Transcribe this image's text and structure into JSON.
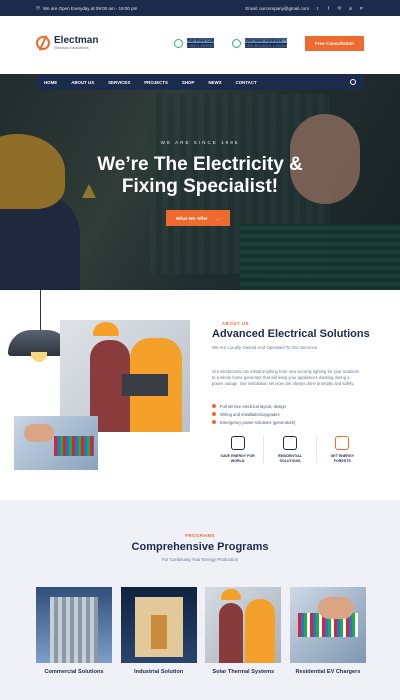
{
  "topbar": {
    "hours": "We are Open Everyday at 09:00 am - 19:00 pm",
    "email": "Email: ourcompany@gmail.com",
    "social": [
      "t",
      "f",
      "◎",
      "in",
      "P"
    ]
  },
  "header": {
    "brand": "Electman",
    "tagline": "Electrical Installations",
    "call_title": "Toll Free Call",
    "call_value": "(+557) 964587",
    "address_title": "Our New Address",
    "address_value": "55/5 Brooklyn, London",
    "cta": "Free Consultation"
  },
  "nav": [
    "HOME",
    "ABOUT US",
    "SERVICES",
    "PROJECTS",
    "SHOP",
    "NEWS",
    "CONTACT"
  ],
  "hero": {
    "since": "WE ARE SINCE 1995",
    "title_line1": "We’re The Electricity &",
    "title_line2": "Fixing Specialist!",
    "button": "What We Offer"
  },
  "about": {
    "sub": "ABOUT US",
    "title": "Advanced Electrical Solutions",
    "lead": "We Are Locally Owned And Operated To Our Services",
    "text": "Our electricians can install anything from new security lighting for your outdoors to a whole home generator that will keep your appliances working during a power outage. Our installation services are always done promptly and safely.",
    "list": [
      "Full service electrical layout, design",
      "Wiring and installation/upgrades",
      "Emergency power solutions (generators)"
    ],
    "features": [
      "SAVE ENERGY FOR WORLD",
      "RESIDENTIAL SOLUTIONS",
      "GET ENERGY FORESTS"
    ]
  },
  "programs": {
    "sub": "PROGRAMS",
    "title": "Comprehensive Programs",
    "lead": "For Continuing Your Energy Production",
    "cards": [
      "Commercial Solutions",
      "Industrial Solution",
      "Solar Thermal Systems",
      "Residential EV Chargers"
    ]
  },
  "colors": {
    "navy": "#1c2a4c",
    "orange": "#ee6a2f",
    "light_bg": "#eff1f7"
  }
}
